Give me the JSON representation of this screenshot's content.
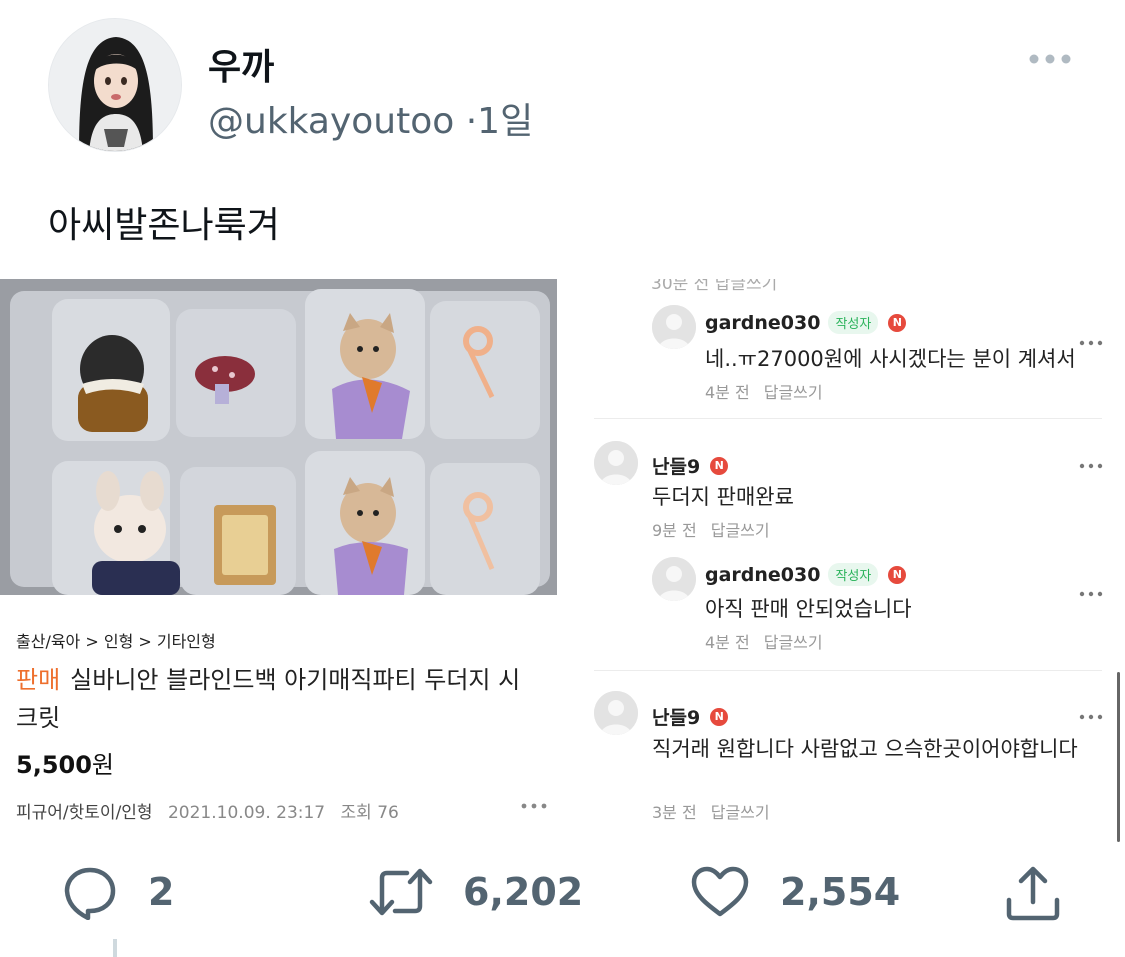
{
  "tweet": {
    "display_name": "우까",
    "handle": "@ukkayoutoo",
    "separator": "·",
    "time": "1일",
    "text": "아씨발존나룩겨"
  },
  "product": {
    "category": "출산/육아 > 인형 > 기타인형",
    "sale_tag": "판매",
    "title": "실바니안 블라인드백 아기매직파티 두더지 시크릿",
    "price_number": "5,500",
    "price_unit": "원",
    "board": "피규어/핫토이/인형",
    "date": "2021.10.09. 23:17",
    "views": "조회 76"
  },
  "comments": {
    "cut_text": "30분 전   답글쓰기",
    "items": [
      {
        "name": "gardne030",
        "author_badge": "작성자",
        "n_badge": "N",
        "text": "네..ㅠ27000원에 사시겠다는 분이 계셔서",
        "time": "4분 전",
        "reply": "답글쓰기"
      },
      {
        "name": "난들9",
        "author_badge": "",
        "n_badge": "N",
        "text": "두더지 판매완료",
        "time": "9분 전",
        "reply": "답글쓰기"
      },
      {
        "name": "gardne030",
        "author_badge": "작성자",
        "n_badge": "N",
        "text": "아직 판매 안되었습니다",
        "time": "4분 전",
        "reply": "답글쓰기"
      },
      {
        "name": "난들9",
        "author_badge": "",
        "n_badge": "N",
        "text": "직거래 원합니다 사람없고 으슥한곳이어야합니다",
        "time": "3분 전",
        "reply": "답글쓰기"
      }
    ]
  },
  "actions": {
    "replies": "2",
    "retweets": "6,202",
    "likes": "2,554"
  },
  "icons": {
    "reply": "reply-icon",
    "retweet": "retweet-icon",
    "like": "heart-icon",
    "share": "share-icon",
    "more": "more-horizontal-icon"
  },
  "colors": {
    "secondary_text": "#536471",
    "sale_orange": "#ee6f2d",
    "author_green": "#2bb35b",
    "new_badge_red": "#e64a3d"
  }
}
